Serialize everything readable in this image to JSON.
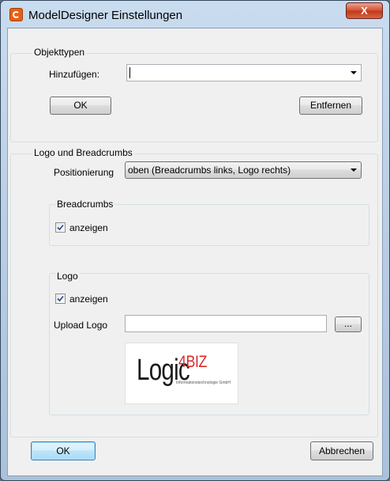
{
  "window": {
    "title": "ModelDesigner Einstellungen",
    "close_glyph": "X"
  },
  "objekttypen": {
    "group_label": "Objekttypen",
    "add_label": "Hinzufügen:",
    "add_value": "",
    "ok_label": "OK",
    "remove_label": "Entfernen"
  },
  "logo_breadcrumbs": {
    "group_label": "Logo und Breadcrumbs",
    "position_label": "Positionierung",
    "position_value": "oben (Breadcrumbs links, Logo rechts)",
    "breadcrumbs": {
      "group_label": "Breadcrumbs",
      "show_label": "anzeigen",
      "show_checked": true
    },
    "logo": {
      "group_label": "Logo",
      "show_label": "anzeigen",
      "show_checked": true,
      "upload_label": "Upload Logo",
      "upload_value": "",
      "browse_label": "...",
      "preview": {
        "main": "Logic",
        "sup": "4BIZ",
        "tagline": "Informationstechnologie GmbH"
      }
    }
  },
  "footer": {
    "ok_label": "OK",
    "cancel_label": "Abbrechen"
  }
}
